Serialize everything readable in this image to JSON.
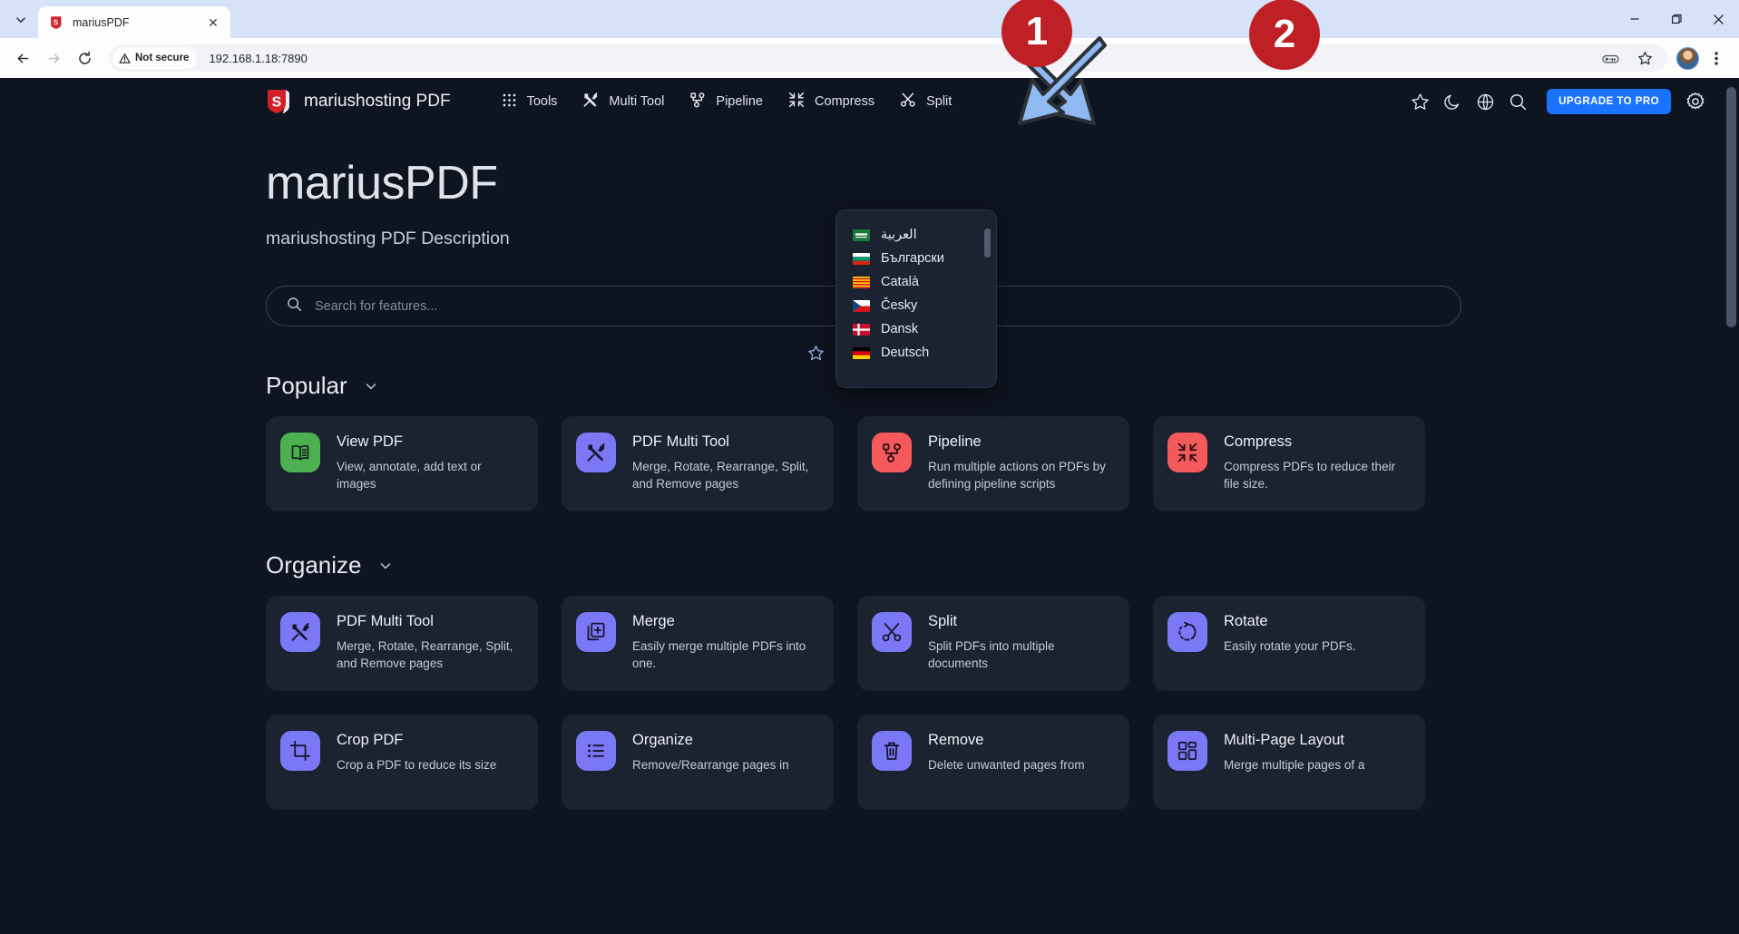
{
  "browser": {
    "tab": {
      "title": "mariusPDF",
      "favicon": "mariushosting-shield-icon",
      "close": "✕"
    },
    "tab_list_icon": "chevron-down-icon",
    "window_controls": [
      "minimize-icon",
      "restore-icon",
      "close-icon"
    ],
    "toolbar": {
      "back": "back-arrow-icon",
      "forward": "forward-arrow-icon",
      "reload": "reload-icon",
      "security_label": "Not secure",
      "security_icon": "warning-triangle-icon",
      "url": "192.168.1.18:7890",
      "password_icon": "password-key-icon",
      "bookmark_icon": "star-icon",
      "profile_icon": "avatar",
      "menu_icon": "three-dots-vertical-icon"
    }
  },
  "app": {
    "brand": {
      "name": "mariushosting PDF",
      "logo": "shield-s-logo"
    },
    "nav": [
      {
        "label": "Tools",
        "icon": "grid-dots-icon"
      },
      {
        "label": "Multi Tool",
        "icon": "tools-icon"
      },
      {
        "label": "Pipeline",
        "icon": "pipeline-icon"
      },
      {
        "label": "Compress",
        "icon": "compress-arrows-icon"
      },
      {
        "label": "Split",
        "icon": "scissors-icon"
      }
    ],
    "actions": {
      "favorites": "star-icon",
      "theme": "moon-icon",
      "language": "globe-icon",
      "search": "search-icon",
      "upgrade_label": "UPGRADE TO PRO",
      "settings": "gear-icon"
    }
  },
  "language_menu": {
    "items": [
      {
        "label": "العربية",
        "flag": "sa"
      },
      {
        "label": "Български",
        "flag": "bg"
      },
      {
        "label": "Català",
        "flag": "cat"
      },
      {
        "label": "Česky",
        "flag": "cz"
      },
      {
        "label": "Dansk",
        "flag": "dk"
      },
      {
        "label": "Deutsch",
        "flag": "de"
      }
    ]
  },
  "hero": {
    "title": "mariusPDF",
    "subtitle": "mariushosting PDF Description"
  },
  "search": {
    "placeholder": "Search for features...",
    "value": "",
    "icon": "search-icon"
  },
  "section_tools": [
    "star-icon",
    "expand-vertical-icon",
    "collapse-vertical-icon"
  ],
  "sections": [
    {
      "title": "Popular",
      "caret": "chevron-down-icon",
      "cards": [
        {
          "title": "View PDF",
          "desc": "View, annotate, add text or images",
          "icon": "book-open-icon",
          "color": "#4caf50",
          "fg": "#12251a"
        },
        {
          "title": "PDF Multi Tool",
          "desc": "Merge, Rotate, Rearrange, Split, and Remove pages",
          "icon": "tools-icon",
          "color": "#7b78f5",
          "fg": "#15172e"
        },
        {
          "title": "Pipeline",
          "desc": "Run multiple actions on PDFs by defining pipeline scripts",
          "icon": "pipeline-icon",
          "color": "#f4595c",
          "fg": "#2a1113"
        },
        {
          "title": "Compress",
          "desc": "Compress PDFs to reduce their file size.",
          "icon": "compress-arrows-icon",
          "color": "#f4595c",
          "fg": "#2a1113"
        }
      ]
    },
    {
      "title": "Organize",
      "caret": "chevron-down-icon",
      "cards": [
        {
          "title": "PDF Multi Tool",
          "desc": "Merge, Rotate, Rearrange, Split, and Remove pages",
          "icon": "tools-icon",
          "color": "#7b78f5",
          "fg": "#15172e"
        },
        {
          "title": "Merge",
          "desc": "Easily merge multiple PDFs into one.",
          "icon": "merge-plus-icon",
          "color": "#7b78f5",
          "fg": "#15172e"
        },
        {
          "title": "Split",
          "desc": "Split PDFs into multiple documents",
          "icon": "scissors-icon",
          "color": "#7b78f5",
          "fg": "#15172e"
        },
        {
          "title": "Rotate",
          "desc": "Easily rotate your PDFs.",
          "icon": "rotate-icon",
          "color": "#7b78f5",
          "fg": "#15172e"
        }
      ]
    },
    {
      "title": "",
      "caret": "",
      "cards": [
        {
          "title": "Crop PDF",
          "desc": "Crop a PDF to reduce its size",
          "icon": "crop-icon",
          "color": "#7b78f5",
          "fg": "#15172e"
        },
        {
          "title": "Organize",
          "desc": "Remove/Rearrange pages in",
          "icon": "list-icon",
          "color": "#7b78f5",
          "fg": "#15172e"
        },
        {
          "title": "Remove",
          "desc": "Delete unwanted pages from",
          "icon": "trash-icon",
          "color": "#7b78f5",
          "fg": "#15172e"
        },
        {
          "title": "Multi-Page Layout",
          "desc": "Merge multiple pages of a",
          "icon": "layout-grid-icon",
          "color": "#7b78f5",
          "fg": "#15172e"
        }
      ]
    }
  ],
  "annotations": [
    {
      "number": "1",
      "target": "theme-toggle-moon-icon"
    },
    {
      "number": "2",
      "target": "language-globe-icon"
    }
  ],
  "colors": {
    "accent": "#1a73ff",
    "annotation": "#bf2026",
    "arrow": "#8fb9f0",
    "page_bg": "#0e1420",
    "card_bg": "#1b2230"
  }
}
